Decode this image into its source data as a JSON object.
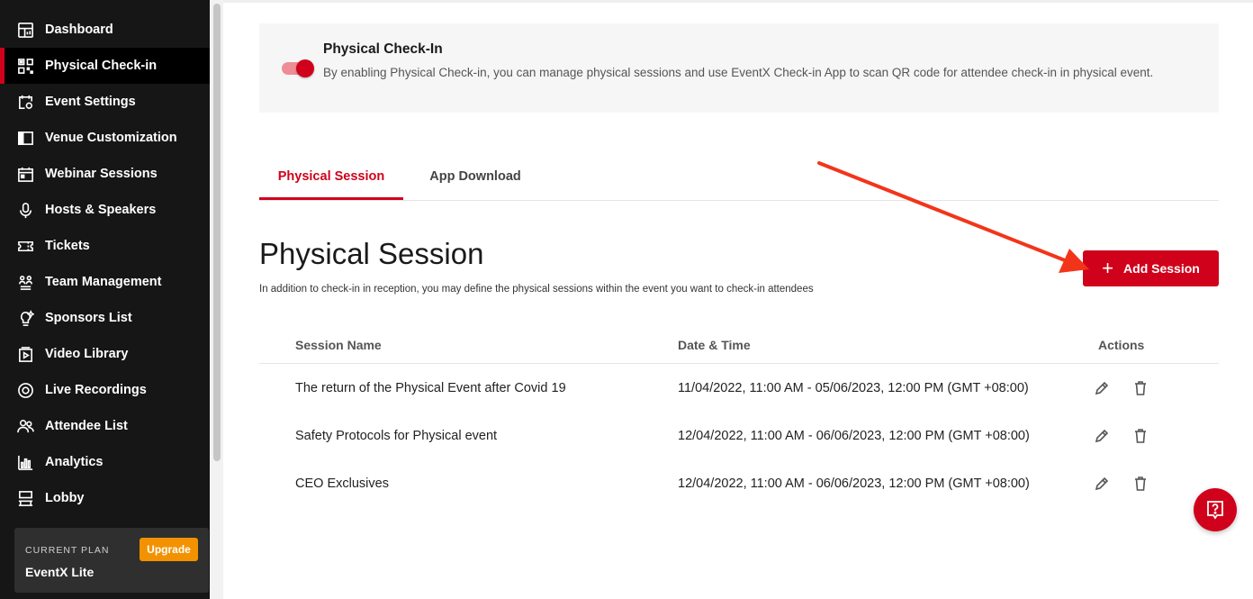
{
  "sidebar": {
    "items": [
      {
        "label": "Dashboard",
        "icon": "dashboard-icon"
      },
      {
        "label": "Physical Check-in",
        "icon": "qr-code-icon",
        "active": true
      },
      {
        "label": "Event Settings",
        "icon": "calendar-settings-icon"
      },
      {
        "label": "Venue Customization",
        "icon": "layout-icon"
      },
      {
        "label": "Webinar Sessions",
        "icon": "calendar-icon"
      },
      {
        "label": "Hosts & Speakers",
        "icon": "microphone-icon"
      },
      {
        "label": "Tickets",
        "icon": "ticket-icon"
      },
      {
        "label": "Team Management",
        "icon": "team-icon"
      },
      {
        "label": "Sponsors List",
        "icon": "sponsor-icon"
      },
      {
        "label": "Video Library",
        "icon": "video-library-icon"
      },
      {
        "label": "Live Recordings",
        "icon": "record-icon"
      },
      {
        "label": "Attendee List",
        "icon": "attendees-icon"
      },
      {
        "label": "Analytics",
        "icon": "analytics-icon"
      },
      {
        "label": "Lobby",
        "icon": "lobby-icon"
      }
    ],
    "plan": {
      "label": "CURRENT PLAN",
      "name": "EventX Lite",
      "upgrade_label": "Upgrade"
    }
  },
  "banner": {
    "title": "Physical Check-In",
    "description": "By enabling Physical Check-in, you can manage physical sessions and use EventX Check-in App to scan QR code for attendee check-in in physical event.",
    "toggle_on": true
  },
  "tabs": [
    {
      "label": "Physical Session",
      "active": true
    },
    {
      "label": "App Download",
      "active": false
    }
  ],
  "section": {
    "title": "Physical Session",
    "description": "In addition to check-in in reception, you may define the physical sessions within the event you want to check-in attendees",
    "add_button_label": "Add Session"
  },
  "table": {
    "headers": {
      "name": "Session Name",
      "date": "Date & Time",
      "actions": "Actions"
    },
    "rows": [
      {
        "name": "The return of the Physical Event after Covid 19",
        "date": "11/04/2022, 11:00 AM - 05/06/2023, 12:00 PM (GMT +08:00)"
      },
      {
        "name": "Safety Protocols for Physical event",
        "date": "12/04/2022, 11:00 AM - 06/06/2023, 12:00 PM (GMT +08:00)"
      },
      {
        "name": "CEO Exclusives",
        "date": "12/04/2022, 11:00 AM - 06/06/2023, 12:00 PM (GMT +08:00)"
      }
    ]
  },
  "colors": {
    "brand": "#d0021b",
    "sidebar_bg": "#161616",
    "upgrade": "#f39200",
    "arrow": "#f2351a"
  }
}
